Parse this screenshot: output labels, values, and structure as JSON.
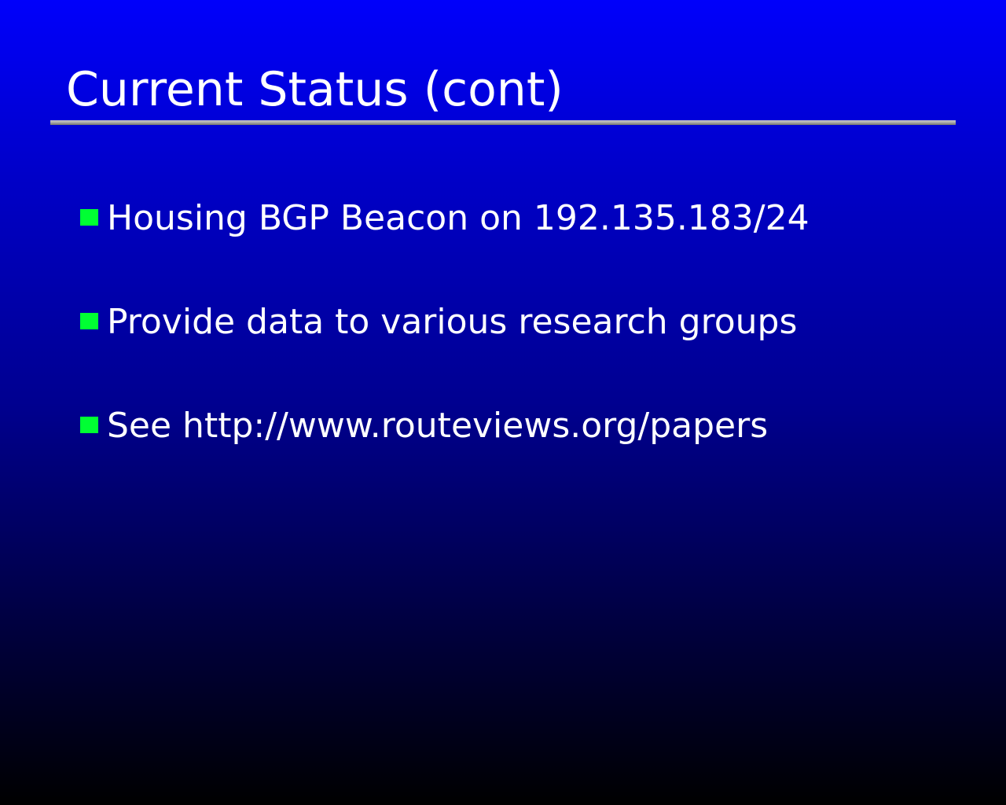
{
  "slide": {
    "title": "Current Status (cont)",
    "bullet_color": "#00ff33",
    "bullets": [
      "Housing BGP Beacon on 192.135.183/24",
      "Provide data to various research groups",
      "See http://www.routeviews.org/papers"
    ]
  }
}
